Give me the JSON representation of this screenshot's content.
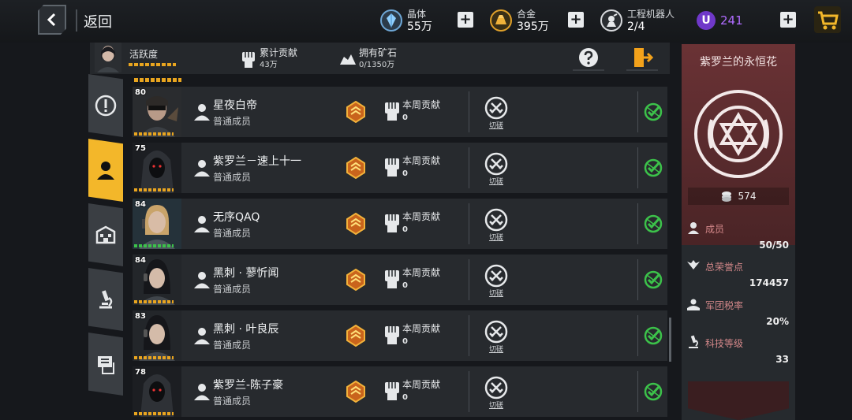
{
  "header": {
    "back_label": "返回",
    "resources": [
      {
        "name": "晶体",
        "value": "55万",
        "icon": "crystal-icon"
      },
      {
        "name": "合金",
        "value": "395万",
        "icon": "alloy-icon"
      },
      {
        "name": "工程机器人",
        "value": "2/4",
        "icon": "robot-icon"
      }
    ],
    "premium": {
      "badge": "U",
      "value": "241"
    }
  },
  "subheader": {
    "activity_label": "活跃度",
    "contribution_label": "累计贡献",
    "contribution_value": "43万",
    "ore_label": "拥有矿石",
    "ore_value": "0/1350万"
  },
  "tabs": [
    {
      "name": "info",
      "icon": "exclamation-icon"
    },
    {
      "name": "members",
      "icon": "person-icon"
    },
    {
      "name": "buildings",
      "icon": "building-icon"
    },
    {
      "name": "tech",
      "icon": "microscope-icon"
    },
    {
      "name": "flag",
      "icon": "flag-icon"
    }
  ],
  "members": {
    "week_label": "本周贡献",
    "duel_label": "切磋",
    "rows": [
      {
        "level": "80",
        "name": "星夜白帝",
        "role": "普通成员",
        "week": "0",
        "bar": "gold",
        "look": "masked"
      },
      {
        "level": "75",
        "name": "紫罗兰－速上十一",
        "role": "普通成员",
        "week": "0",
        "bar": "gold",
        "look": "hooded"
      },
      {
        "level": "84",
        "name": "无序QAQ",
        "role": "普通成员",
        "week": "0",
        "bar": "green",
        "look": "blonde"
      },
      {
        "level": "84",
        "name": "黑刺 · 蓼忻闻",
        "role": "普通成员",
        "week": "0",
        "bar": "gold",
        "look": "darkhair"
      },
      {
        "level": "83",
        "name": "黑刺 · 叶良辰",
        "role": "普通成员",
        "week": "0",
        "bar": "gold",
        "look": "darkhair"
      },
      {
        "level": "78",
        "name": "紫罗兰-陈子豪",
        "role": "普通成员",
        "week": "0",
        "bar": "gold",
        "look": "hooded"
      }
    ]
  },
  "legion": {
    "name": "紫罗兰的永恒花",
    "coins": "574",
    "stats": [
      {
        "label": "成员",
        "value": "50/50",
        "icon": "member-icon"
      },
      {
        "label": "总荣誉点",
        "value": "174457",
        "icon": "wings-icon"
      },
      {
        "label": "军团税率",
        "value": "20%",
        "icon": "tax-icon"
      },
      {
        "label": "科技等级",
        "value": "33",
        "icon": "microscope-icon"
      }
    ]
  },
  "colors": {
    "accent": "#f3b72a",
    "panel_red": "#6a3235",
    "premium": "#b06cff",
    "online_green": "#3cc24a"
  }
}
